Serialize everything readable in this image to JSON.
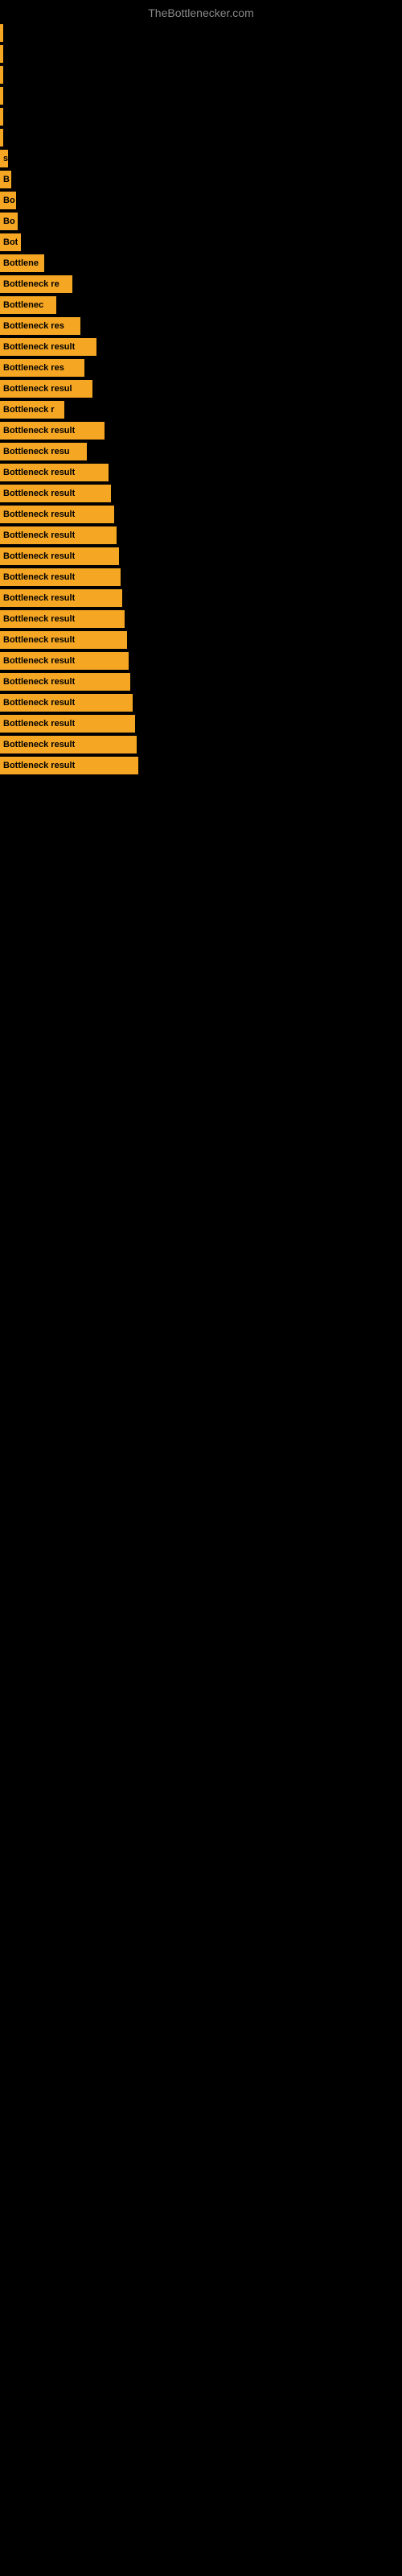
{
  "site_title": "TheBottlenecker.com",
  "bars": [
    {
      "label": "",
      "width": 2
    },
    {
      "label": "",
      "width": 2
    },
    {
      "label": "",
      "width": 3
    },
    {
      "label": "",
      "width": 3
    },
    {
      "label": "",
      "width": 3
    },
    {
      "label": "",
      "width": 4
    },
    {
      "label": "s",
      "width": 10
    },
    {
      "label": "B",
      "width": 14
    },
    {
      "label": "Bo",
      "width": 20
    },
    {
      "label": "Bo",
      "width": 22
    },
    {
      "label": "Bot",
      "width": 26
    },
    {
      "label": "Bottlene",
      "width": 55
    },
    {
      "label": "Bottleneck re",
      "width": 90
    },
    {
      "label": "Bottlenec",
      "width": 70
    },
    {
      "label": "Bottleneck res",
      "width": 100
    },
    {
      "label": "Bottleneck result",
      "width": 120
    },
    {
      "label": "Bottleneck res",
      "width": 105
    },
    {
      "label": "Bottleneck resul",
      "width": 115
    },
    {
      "label": "Bottleneck r",
      "width": 80
    },
    {
      "label": "Bottleneck result",
      "width": 130
    },
    {
      "label": "Bottleneck resu",
      "width": 108
    },
    {
      "label": "Bottleneck result",
      "width": 135
    },
    {
      "label": "Bottleneck result",
      "width": 138
    },
    {
      "label": "Bottleneck result",
      "width": 142
    },
    {
      "label": "Bottleneck result",
      "width": 145
    },
    {
      "label": "Bottleneck result",
      "width": 148
    },
    {
      "label": "Bottleneck result",
      "width": 150
    },
    {
      "label": "Bottleneck result",
      "width": 152
    },
    {
      "label": "Bottleneck result",
      "width": 155
    },
    {
      "label": "Bottleneck result",
      "width": 158
    },
    {
      "label": "Bottleneck result",
      "width": 160
    },
    {
      "label": "Bottleneck result",
      "width": 162
    },
    {
      "label": "Bottleneck result",
      "width": 165
    },
    {
      "label": "Bottleneck result",
      "width": 168
    },
    {
      "label": "Bottleneck result",
      "width": 170
    },
    {
      "label": "Bottleneck result",
      "width": 172
    }
  ]
}
